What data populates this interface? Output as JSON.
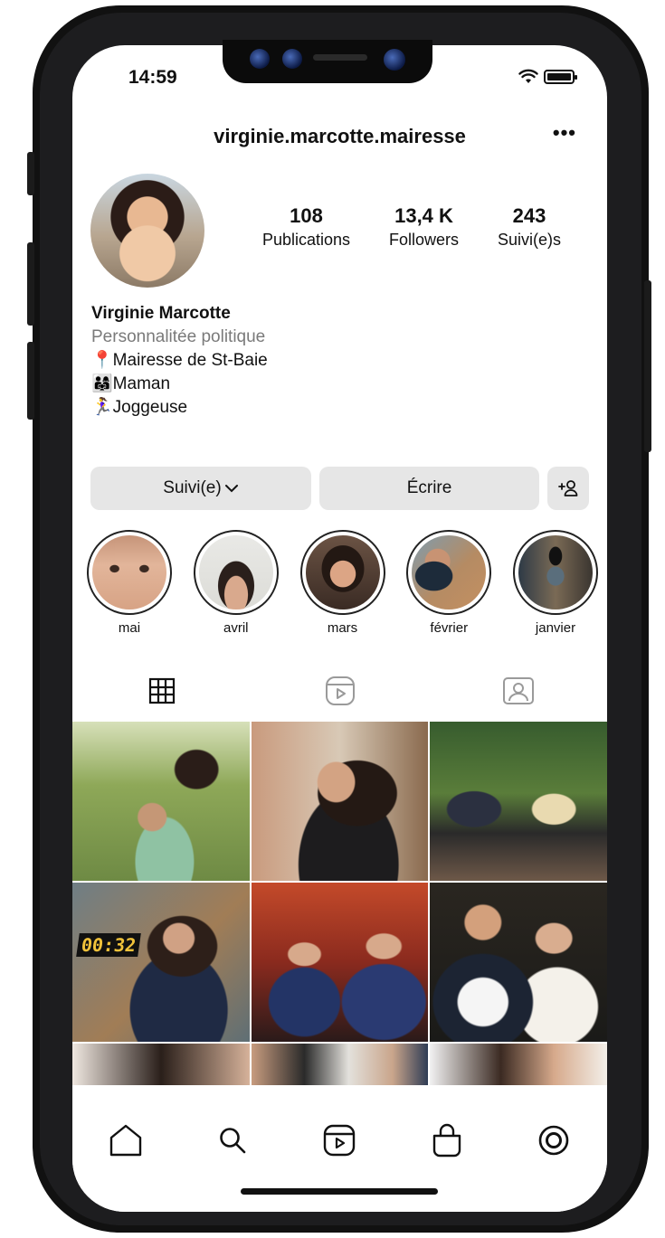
{
  "status": {
    "time": "14:59",
    "battery_level": 1.0
  },
  "profile": {
    "username": "virginie.marcotte.mairesse",
    "more_label": "•••",
    "stats": [
      {
        "value": "108",
        "label": "Publications"
      },
      {
        "value": "13,4 K",
        "label": "Followers"
      },
      {
        "value": "243",
        "label": "Suivi(e)s"
      }
    ],
    "name": "Virginie Marcotte",
    "category": "Personnalitée politique",
    "bio_lines": [
      {
        "emoji": "📍",
        "text": "Mairesse de St-Baie"
      },
      {
        "emoji": "👨‍👩‍👧",
        "text": "Maman"
      },
      {
        "emoji": "🏃‍♀️",
        "text": "Joggeuse"
      }
    ]
  },
  "actions": {
    "follow_label": "Suivi(e)",
    "message_label": "Écrire",
    "add_label": "+👤"
  },
  "highlights": [
    {
      "label": "mai"
    },
    {
      "label": "avril"
    },
    {
      "label": "mars"
    },
    {
      "label": "février"
    },
    {
      "label": "janvier"
    }
  ],
  "tabs": [
    {
      "name": "grid-icon",
      "active": true
    },
    {
      "name": "reels-icon",
      "active": false
    },
    {
      "name": "tagged-icon",
      "active": false
    }
  ],
  "posts_visible": 9,
  "video_timestamp": "00:32",
  "bottom_nav": [
    "home-icon",
    "search-icon",
    "reels-icon",
    "shop-icon",
    "profile-icon"
  ],
  "colors": {
    "button_bg": "#e6e6e6",
    "text": "#111111",
    "muted": "#7a7a7a"
  }
}
